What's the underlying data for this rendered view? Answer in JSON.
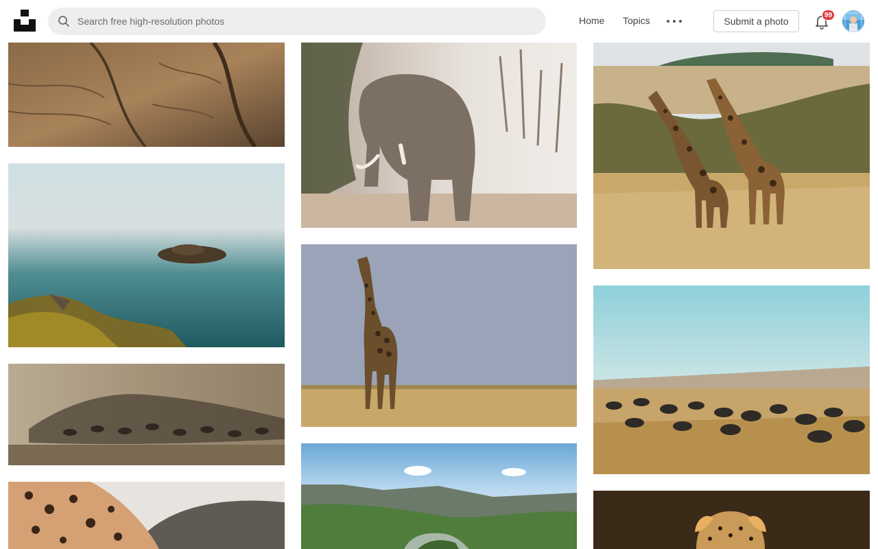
{
  "header": {
    "logo_icon": "unsplash-logo-icon",
    "search": {
      "placeholder": "Search free high-resolution photos",
      "value": "",
      "icon": "search-icon"
    },
    "nav": {
      "home": "Home",
      "topics": "Topics",
      "more_icon": "more-dots-icon"
    },
    "submit_label": "Submit a photo",
    "notifications": {
      "icon": "bell-icon",
      "count": "99"
    },
    "avatar_icon": "user-avatar",
    "colors": {
      "badge": "#e03c3c",
      "search_bg": "#eeeeee",
      "border": "#cfcfcf"
    }
  },
  "gallery": {
    "columns": [
      {
        "photos": [
          {
            "subject": "elephant-skin"
          },
          {
            "subject": "lake-island"
          },
          {
            "subject": "wildebeest-dust"
          },
          {
            "subject": "leopard-rock"
          }
        ]
      },
      {
        "photos": [
          {
            "subject": "elephant-dust"
          },
          {
            "subject": "giraffe-sky"
          },
          {
            "subject": "canyon-river"
          }
        ]
      },
      {
        "photos": [
          {
            "subject": "two-giraffes"
          },
          {
            "subject": "wildebeest-migration"
          },
          {
            "subject": "leopard-face"
          }
        ]
      }
    ]
  }
}
